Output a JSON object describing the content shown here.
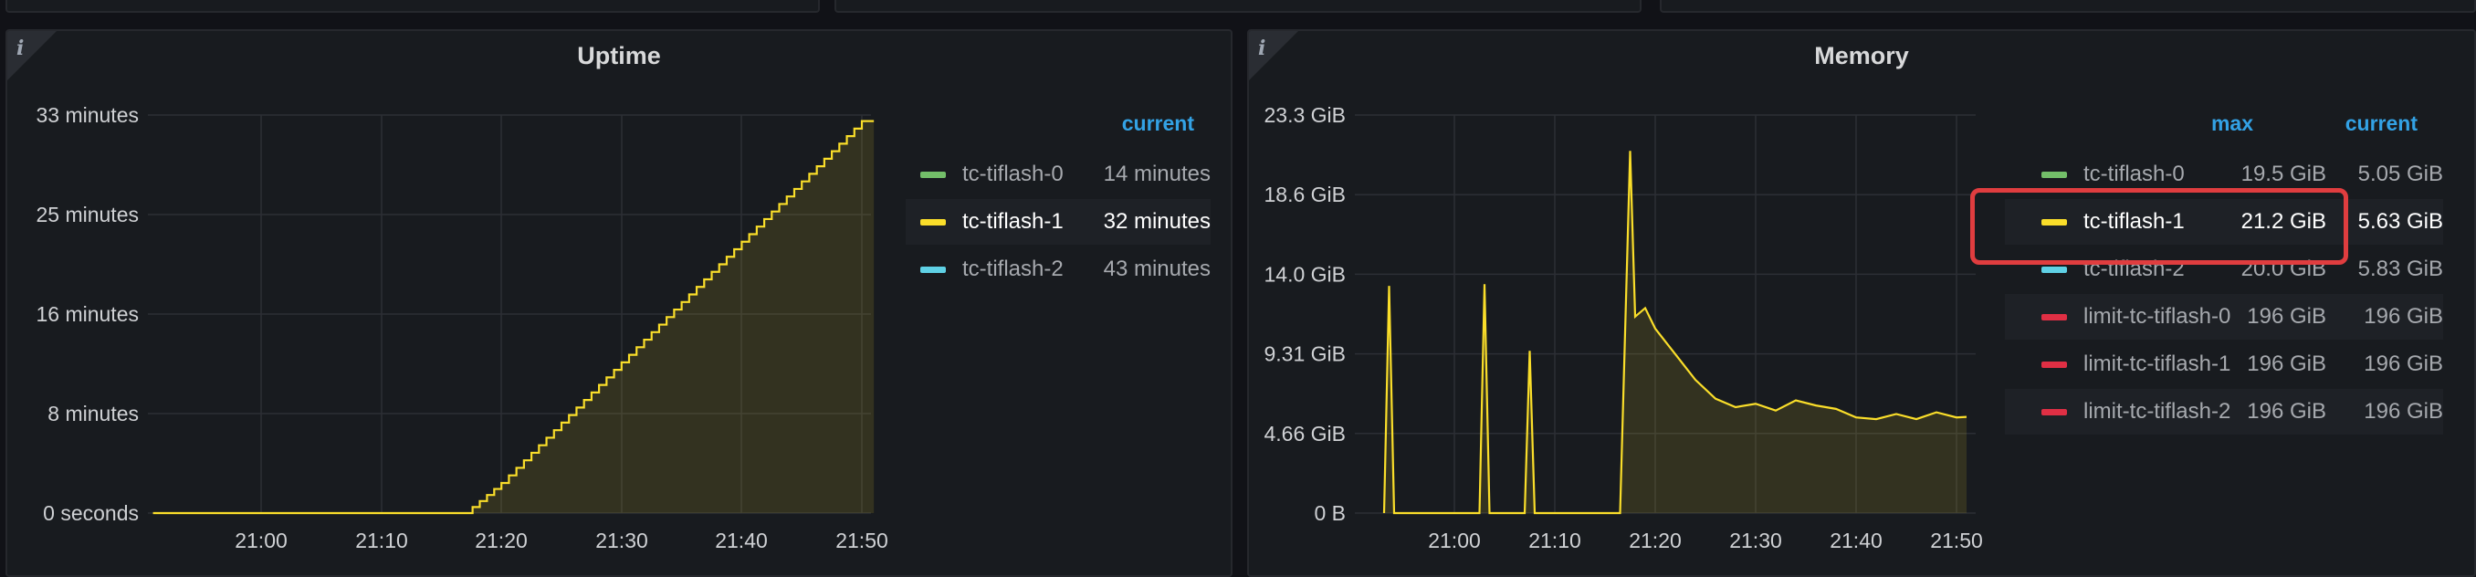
{
  "panels": [
    {
      "title": "Uptime",
      "legend_header": {
        "current": "current"
      },
      "legend": [
        {
          "name": "tc-tiflash-0",
          "current": "14 minutes",
          "color": "#73bf69"
        },
        {
          "name": "tc-tiflash-1",
          "current": "32 minutes",
          "color": "#fade2a"
        },
        {
          "name": "tc-tiflash-2",
          "current": "43 minutes",
          "color": "#5fd1e5"
        }
      ]
    },
    {
      "title": "Memory",
      "legend_header": {
        "max": "max",
        "current": "current"
      },
      "legend": [
        {
          "name": "tc-tiflash-0",
          "max": "19.5 GiB",
          "current": "5.05 GiB",
          "color": "#73bf69"
        },
        {
          "name": "tc-tiflash-1",
          "max": "21.2 GiB",
          "current": "5.63 GiB",
          "color": "#fade2a"
        },
        {
          "name": "tc-tiflash-2",
          "max": "20.0 GiB",
          "current": "5.83 GiB",
          "color": "#5fd1e5"
        },
        {
          "name": "limit-tc-tiflash-0",
          "max": "196 GiB",
          "current": "196 GiB",
          "color": "#e02f44"
        },
        {
          "name": "limit-tc-tiflash-1",
          "max": "196 GiB",
          "current": "196 GiB",
          "color": "#e02f44"
        },
        {
          "name": "limit-tc-tiflash-2",
          "max": "196 GiB",
          "current": "196 GiB",
          "color": "#e02f44"
        }
      ]
    }
  ],
  "chart_data": [
    {
      "type": "line",
      "title": "Uptime",
      "yticks": [
        "0 seconds",
        "8 minutes",
        "16 minutes",
        "25 minutes",
        "33 minutes"
      ],
      "xticks": [
        "21:00",
        "21:10",
        "21:20",
        "21:30",
        "21:40",
        "21:50"
      ],
      "ylim": [
        0,
        33
      ],
      "y_unit": "minutes",
      "grid": true,
      "legend_placement": "right",
      "series": [
        {
          "name": "tc-tiflash-1",
          "color": "#fade2a",
          "x": [
            "20:51",
            "21:00",
            "21:10",
            "21:17",
            "21:20",
            "21:30",
            "21:40",
            "21:50",
            "21:51"
          ],
          "values": [
            0,
            0,
            0,
            0,
            2.5,
            12.5,
            22.5,
            32.5,
            32.5
          ]
        }
      ]
    },
    {
      "type": "line",
      "title": "Memory",
      "yticks": [
        "0 B",
        "4.66 GiB",
        "9.31 GiB",
        "14.0 GiB",
        "18.6 GiB",
        "23.3 GiB"
      ],
      "xticks": [
        "21:00",
        "21:10",
        "21:20",
        "21:30",
        "21:40",
        "21:50"
      ],
      "ylim": [
        0,
        23.3
      ],
      "y_unit": "GiB",
      "grid": true,
      "legend_placement": "right",
      "series": [
        {
          "name": "tc-tiflash-1",
          "color": "#fade2a",
          "x": [
            "20:53",
            "20:53.5",
            "20:54",
            "21:02.5",
            "21:03",
            "21:03.5",
            "21:07",
            "21:07.5",
            "21:08",
            "21:16.5",
            "21:17.5",
            "21:18",
            "21:19",
            "21:20",
            "21:22",
            "21:24",
            "21:26",
            "21:28",
            "21:30",
            "21:32",
            "21:34",
            "21:36",
            "21:38",
            "21:40",
            "21:42",
            "21:44",
            "21:46",
            "21:48",
            "21:50",
            "21:51"
          ],
          "values": [
            0,
            13.3,
            0,
            0,
            13.4,
            0,
            0,
            9.5,
            0,
            0,
            21.2,
            11.5,
            12.0,
            10.8,
            9.3,
            7.8,
            6.7,
            6.2,
            6.4,
            6.0,
            6.6,
            6.3,
            6.1,
            5.6,
            5.5,
            5.8,
            5.5,
            5.9,
            5.6,
            5.63
          ]
        }
      ]
    }
  ]
}
